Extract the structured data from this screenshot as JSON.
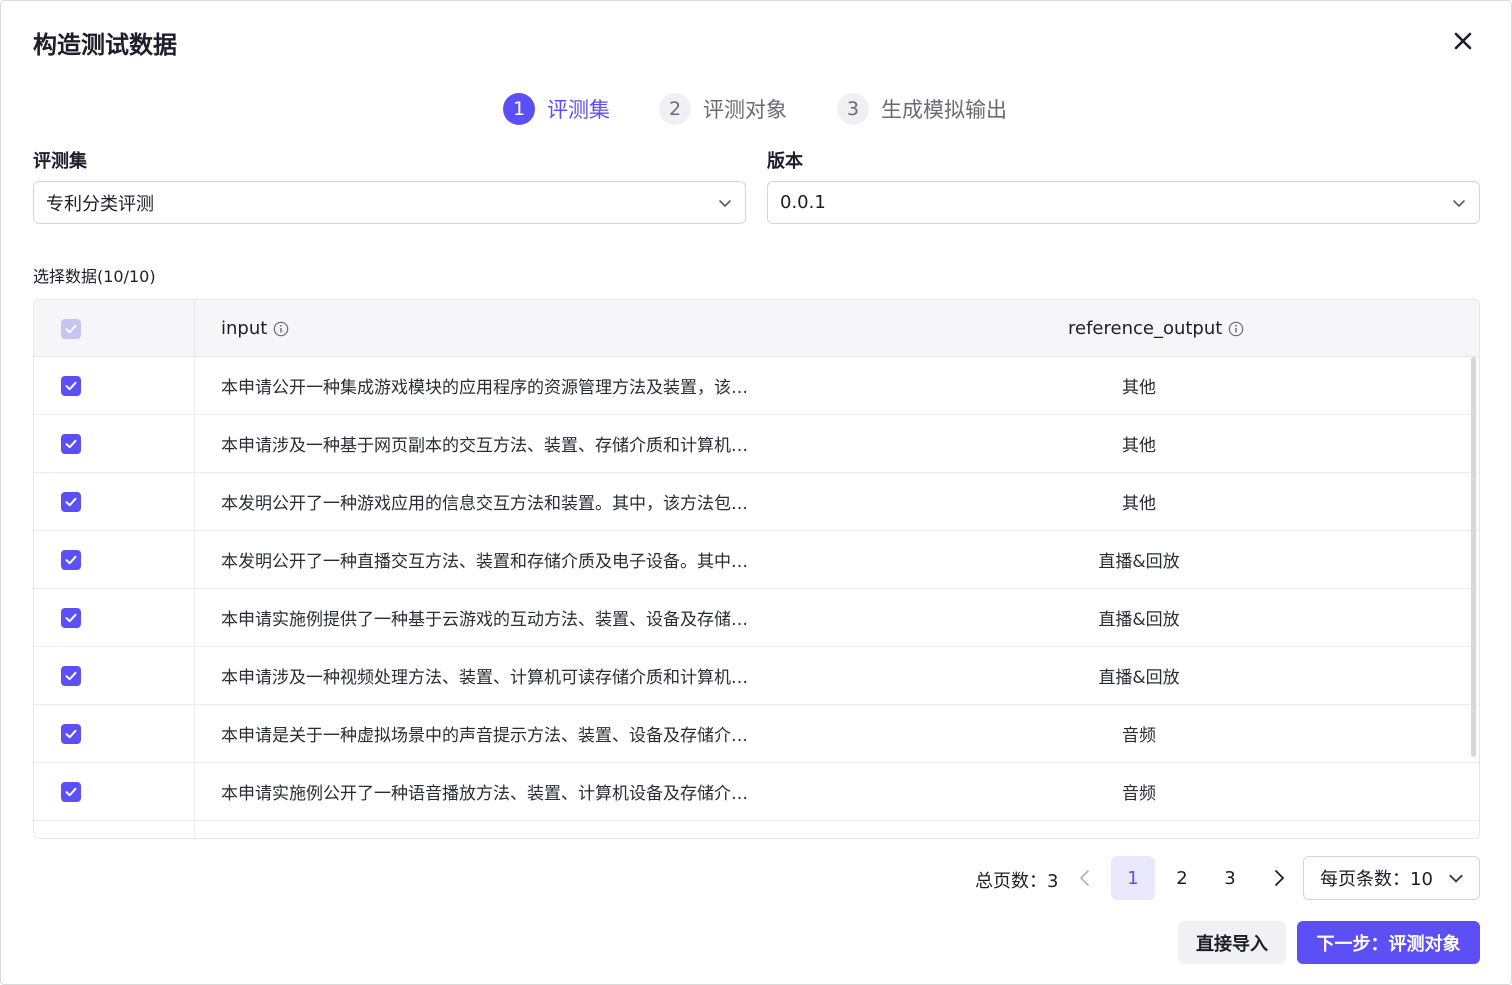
{
  "dialog": {
    "title": "构造测试数据",
    "close_icon": "close-icon"
  },
  "steps": [
    {
      "num": "1",
      "label": "评测集",
      "state": "active"
    },
    {
      "num": "2",
      "label": "评测对象",
      "state": "inactive"
    },
    {
      "num": "3",
      "label": "生成模拟输出",
      "state": "inactive"
    }
  ],
  "form": {
    "dataset_label": "评测集",
    "dataset_value": "专利分类评测",
    "version_label": "版本",
    "version_value": "0.0.1"
  },
  "selection": {
    "label": "选择数据(10/10)"
  },
  "table": {
    "columns": [
      "input",
      "reference_output"
    ],
    "rows": [
      {
        "input": "本申请公开一种集成游戏模块的应用程序的资源管理方法及装置，该…",
        "reference_output": "其他",
        "checked": true
      },
      {
        "input": "本申请涉及一种基于网页副本的交互方法、装置、存储介质和计算机…",
        "reference_output": "其他",
        "checked": true
      },
      {
        "input": "本发明公开了一种游戏应用的信息交互方法和装置。其中，该方法包…",
        "reference_output": "其他",
        "checked": true
      },
      {
        "input": "本发明公开了一种直播交互方法、装置和存储介质及电子设备。其中…",
        "reference_output": "直播&回放",
        "checked": true
      },
      {
        "input": "本申请实施例提供了一种基于云游戏的互动方法、装置、设备及存储…",
        "reference_output": "直播&回放",
        "checked": true
      },
      {
        "input": "本申请涉及一种视频处理方法、装置、计算机可读存储介质和计算机…",
        "reference_output": "直播&回放",
        "checked": true
      },
      {
        "input": "本申请是关于一种虚拟场景中的声音提示方法、装置、设备及存储介…",
        "reference_output": "音频",
        "checked": true
      },
      {
        "input": "本申请实施例公开了一种语音播放方法、装置、计算机设备及存储介…",
        "reference_output": "音频",
        "checked": true
      }
    ]
  },
  "pagination": {
    "total_label": "总页数：3",
    "pages": [
      "1",
      "2",
      "3"
    ],
    "current_page": "1",
    "page_size_label": "每页条数：10"
  },
  "actions": {
    "import_label": "直接导入",
    "next_label": "下一步：评测对象"
  },
  "colors": {
    "accent": "#5b4ff5",
    "accent_light": "#e9e8fd"
  }
}
